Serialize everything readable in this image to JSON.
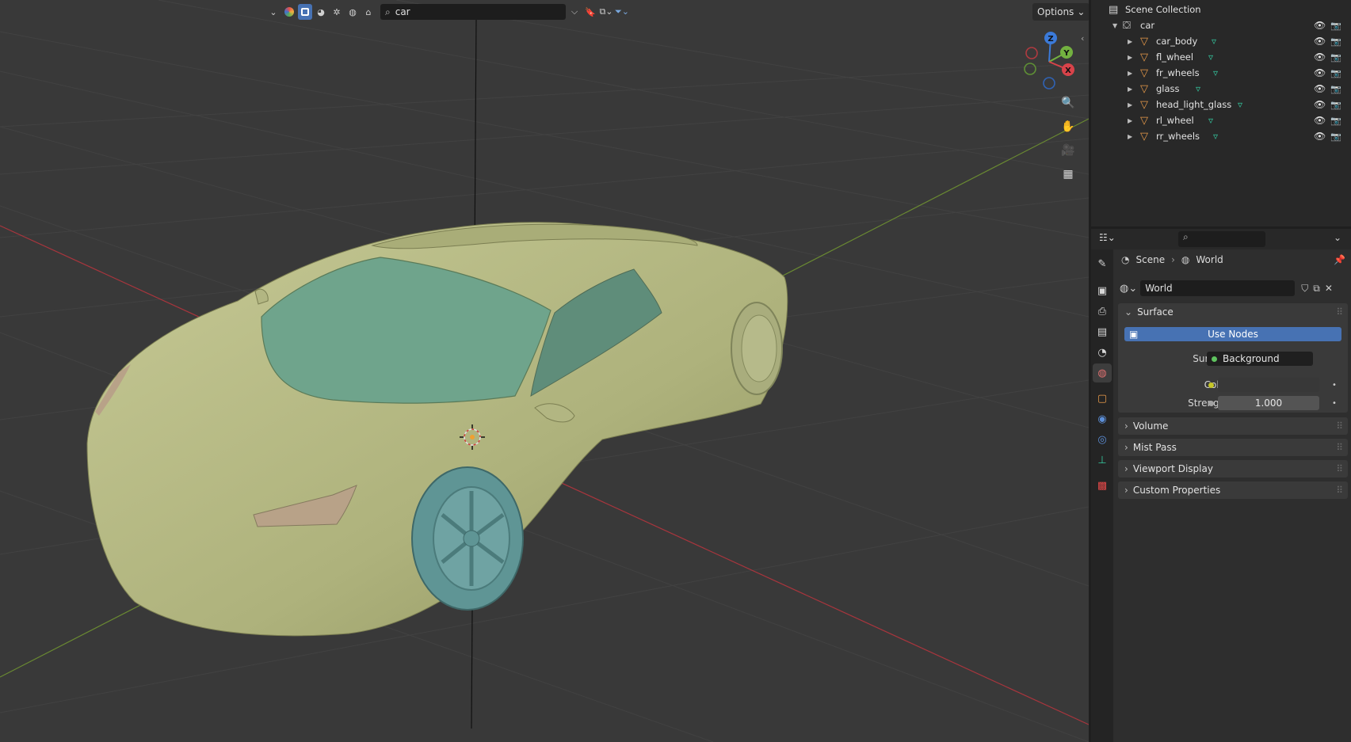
{
  "viewport": {
    "header": {
      "search_value": "car",
      "options_label": "Options"
    }
  },
  "gizmo": {
    "z_label": "Z",
    "y_label": "Y",
    "x_label": "X"
  },
  "outliner": {
    "root_label": "Scene Collection",
    "collection_label": "car",
    "items": [
      {
        "label": "car_body"
      },
      {
        "label": "fl_wheel"
      },
      {
        "label": "fr_wheels"
      },
      {
        "label": "glass"
      },
      {
        "label": "head_light_glass"
      },
      {
        "label": "rl_wheel"
      },
      {
        "label": "rr_wheels"
      }
    ]
  },
  "properties": {
    "breadcrumb": {
      "scene": "Scene",
      "world": "World"
    },
    "world_name": "World",
    "surface_panel": {
      "title": "Surface",
      "use_nodes_label": "Use Nodes",
      "surface_label": "Surface",
      "surface_value": "Background",
      "color_label": "Color",
      "strength_label": "Strength",
      "strength_value": "1.000"
    },
    "panels": [
      {
        "title": "Volume"
      },
      {
        "title": "Mist Pass"
      },
      {
        "title": "Viewport Display"
      },
      {
        "title": "Custom Properties"
      }
    ]
  },
  "colors": {
    "accent_blue": "#4772b3",
    "mesh_icon": "#35c9a0",
    "object_icon": "#e89a4a",
    "car_body": "#b9bd88",
    "glass": "#6fa38a",
    "wheel": "#5f9595"
  }
}
